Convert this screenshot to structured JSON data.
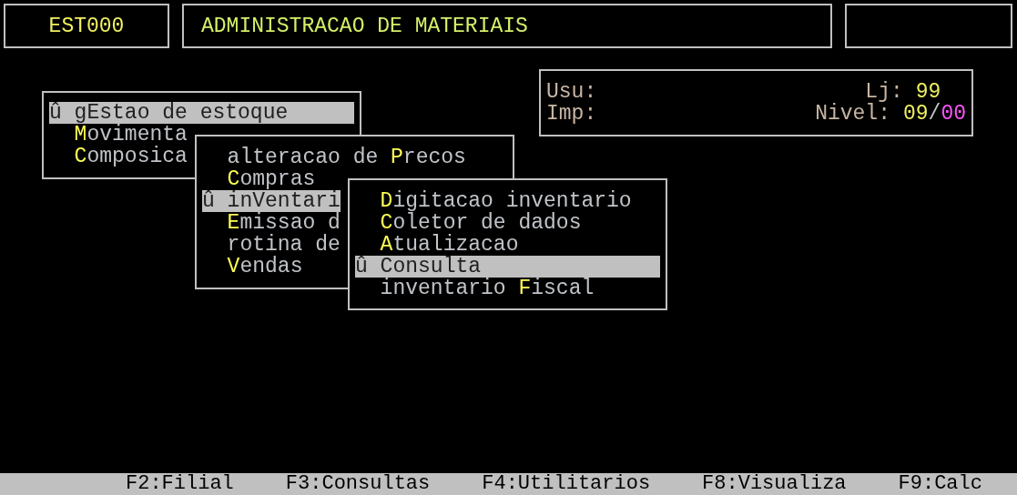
{
  "header": {
    "code": "EST000",
    "title": "ADMINISTRACAO DE MATERIAIS"
  },
  "info": {
    "usu_label": "Usu:",
    "imp_label": "Imp:",
    "lj_label": "Lj:",
    "lj_value": "99",
    "nivel_label": "Nivel:",
    "nivel_value": "09",
    "nivel_separator": "/",
    "nivel_max": "00"
  },
  "menus": [
    {
      "items": [
        {
          "marker": "û",
          "before": "g",
          "key": "E",
          "after": "stao de estoque",
          "selected": true
        },
        {
          "key": "M",
          "after": "ovimenta",
          "selected": false
        },
        {
          "key": "C",
          "after": "omposica",
          "selected": false
        }
      ]
    },
    {
      "items": [
        {
          "before": "alteracao de ",
          "key": "P",
          "after": "recos",
          "selected": false
        },
        {
          "key": "C",
          "after": "ompras",
          "selected": false
        },
        {
          "marker": "û",
          "before": "in",
          "key": "V",
          "after": "entari",
          "selected": true
        },
        {
          "key": "E",
          "after": "missao d",
          "selected": false
        },
        {
          "before": "rotina de",
          "selected": false
        },
        {
          "key": "V",
          "after": "endas",
          "selected": false
        }
      ]
    },
    {
      "items": [
        {
          "key": "D",
          "after": "igitacao inventario",
          "selected": false
        },
        {
          "key": "C",
          "after": "oletor de dados",
          "selected": false
        },
        {
          "key": "A",
          "after": "tualizacao",
          "selected": false
        },
        {
          "marker": "û",
          "key": "C",
          "after": "onsulta",
          "selected": true
        },
        {
          "before": "inventario ",
          "key": "F",
          "after": "iscal",
          "selected": false
        }
      ]
    }
  ],
  "function_keys": [
    "F2:Filial",
    "F3:Consultas",
    "F4:Utilitarios",
    "F8:Visualiza",
    "F9:Calc"
  ]
}
